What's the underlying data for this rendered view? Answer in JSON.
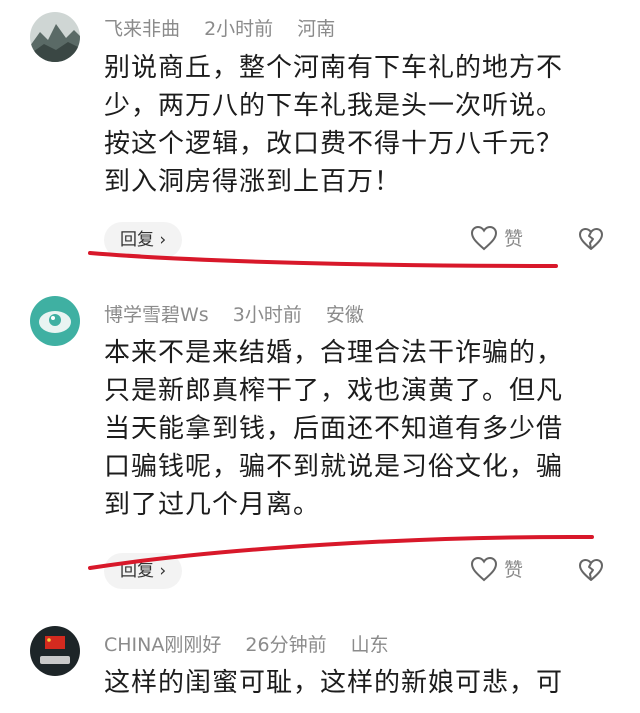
{
  "comments": [
    {
      "username": "飞来非曲",
      "time": "2小时前",
      "location": "河南",
      "lines": [
        "别说商丘，整个河南有下车礼的地方不",
        "少，两万八的下车礼我是头一次听说。",
        "按这个逻辑，改口费不得十万八千元？",
        "到入洞房得涨到上百万！"
      ],
      "reply_label": "回复",
      "like_label": "赞"
    },
    {
      "username": "博学雪碧Ws",
      "time": "3小时前",
      "location": "安徽",
      "lines": [
        "本来不是来结婚，合理合法干诈骗的，",
        "只是新郎真榨干了，戏也演黄了。但凡",
        "当天能拿到钱，后面还不知道有多少借",
        "口骗钱呢，骗不到就说是习俗文化，骗",
        "到了过几个月离。"
      ],
      "reply_label": "回复",
      "like_label": "赞"
    },
    {
      "username": "CHINA刚刚好",
      "time": "26分钟前",
      "location": "山东",
      "lines": [
        "这样的闺蜜可耻，这样的新娘可悲，可"
      ]
    }
  ],
  "icons": {
    "like": "heart-outline-icon",
    "dislike": "broken-heart-icon",
    "reply_arrow": "chevron-right-icon"
  },
  "colors": {
    "underline": "#d8182a",
    "meta_text": "#8b8b8b"
  }
}
